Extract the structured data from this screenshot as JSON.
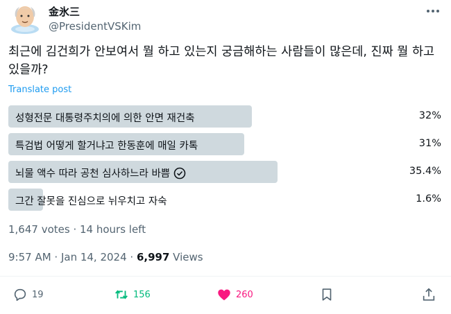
{
  "author": {
    "name": "金氷三",
    "handle": "@PresidentVSKim"
  },
  "tweet": {
    "text": "최근에 김건희가 안보여서 뭘 하고 있는지 궁금해하는 사람들이 많은데, 진짜 뭘 하고 있을까?",
    "translate_label": "Translate post"
  },
  "poll": {
    "options": [
      {
        "label": "성형전문 대통령주치의에 의한 안면 재건축",
        "percent_label": "32%",
        "percent": 32,
        "winner": false
      },
      {
        "label": "특검법 어떻게 할거냐고 한동훈에 매일 카톡",
        "percent_label": "31%",
        "percent": 31,
        "winner": false
      },
      {
        "label": "뇌물 액수 따라 공천 심사하느라 바쁨",
        "percent_label": "35.4%",
        "percent": 35.4,
        "winner": true
      },
      {
        "label": "그간 잘못을 진심으로 뉘우치고 자숙",
        "percent_label": "1.6%",
        "percent": 1.6,
        "winner": false
      }
    ],
    "summary": "1,647 votes · 14 hours left"
  },
  "meta": {
    "timestamp": "9:57 AM · Jan 14, 2024 · ",
    "views_count": "6,997",
    "views_label": " Views"
  },
  "actions": {
    "reply_count": "19",
    "retweet_count": "156",
    "like_count": "260"
  },
  "colors": {
    "poll_fill": "#cfd9de",
    "link": "#1d9bf0",
    "retweet": "#00ba7c",
    "like": "#f91880",
    "muted": "#536471"
  },
  "icons": [
    "more-icon",
    "check-circle-icon",
    "reply-icon",
    "retweet-icon",
    "heart-icon",
    "bookmark-icon",
    "share-icon"
  ]
}
